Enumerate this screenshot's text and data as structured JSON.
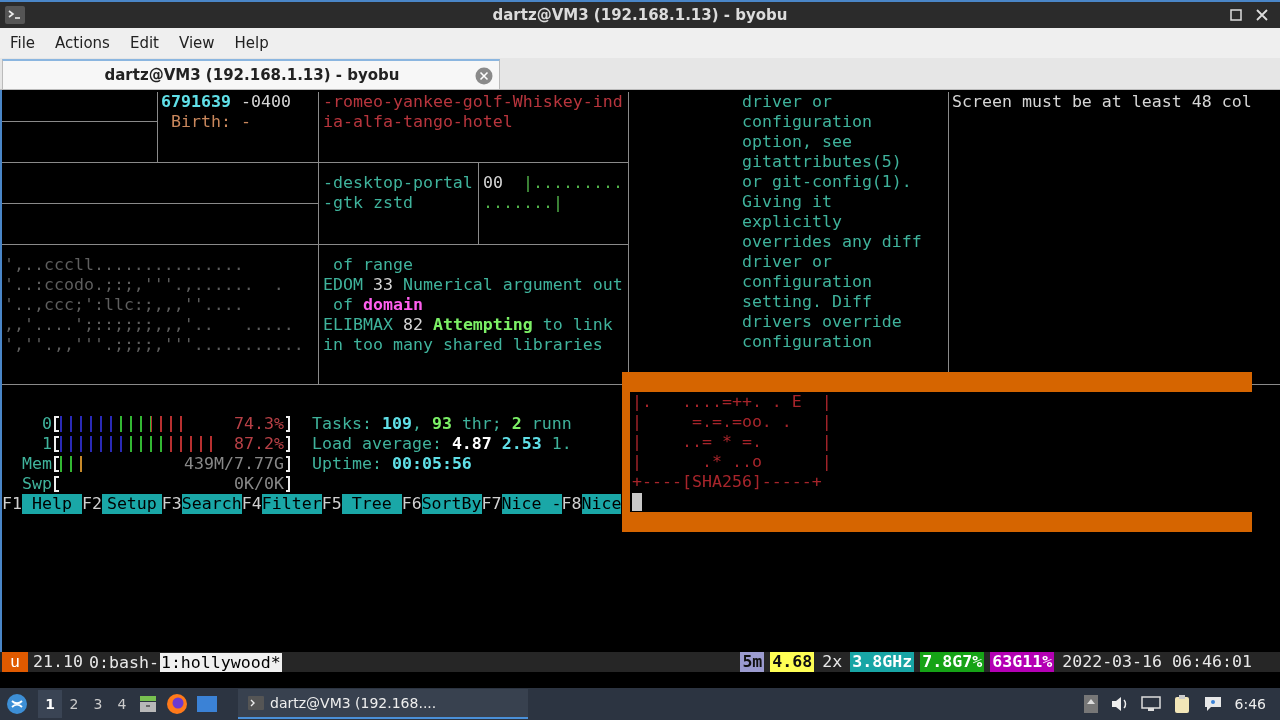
{
  "window": {
    "title": "dartz@VM3 (192.168.1.13) - byobu"
  },
  "menu": [
    "File",
    "Actions",
    "Edit",
    "View",
    "Help"
  ],
  "tabs": [
    {
      "label": "dartz@VM3 (192.168.1.13) - byobu",
      "selected": true
    }
  ],
  "panes": [
    {
      "lines": [
        [
          {
            "text": "6791639",
            "kind": "value"
          },
          {
            "text": " -0400",
            "kind": "plain"
          }
        ],
        [
          {
            "text": " Birth: -",
            "kind": "warning"
          }
        ]
      ]
    },
    {
      "lines": [
        [
          {
            "text": "-romeo-yankee-golf-Whiskey-ind",
            "kind": "error"
          }
        ],
        [
          {
            "text": "ia-alfa-tango-hotel",
            "kind": "error"
          }
        ]
      ]
    },
    {
      "lines": [
        [
          {
            "text": "-desktop-portal",
            "kind": "text"
          }
        ],
        [
          {
            "text": "-gtk zstd",
            "kind": "text"
          }
        ]
      ]
    },
    {
      "lines": [
        [
          {
            "text": "00",
            "kind": "plain"
          },
          {
            "text": "  |.........",
            "kind": "dots"
          }
        ],
        [
          {
            "text": ".......|",
            "kind": "dots"
          }
        ]
      ]
    },
    {
      "lines": [
        [
          {
            "text": "',..cccll...............",
            "kind": "dim"
          }
        ],
        [
          {
            "text": "'..:ccodo.;:;,'''.,......  .",
            "kind": "dim"
          }
        ],
        [
          {
            "text": "'..,ccc;':llc:;,,,''....",
            "kind": "dim"
          }
        ],
        [
          {
            "text": ",,'....';::;;;;,,,'..   .....",
            "kind": "dim"
          }
        ],
        [
          {
            "text": "',''.,,'''.;;;;,'''...........",
            "kind": "dim"
          }
        ]
      ]
    },
    {
      "lines": [
        [
          {
            "text": " of range",
            "kind": "text"
          }
        ],
        [
          {
            "text": "EDOM",
            "kind": "text"
          },
          {
            "text": " 33 ",
            "kind": "plain"
          },
          {
            "text": "Numerical argument out",
            "kind": "text"
          }
        ],
        [
          {
            "text": " of ",
            "kind": "text"
          },
          {
            "text": "domain",
            "kind": "keyword"
          }
        ],
        [
          {
            "text": "ELIBMAX",
            "kind": "text"
          },
          {
            "text": " 82 ",
            "kind": "plain"
          },
          {
            "text": "Attempting",
            "kind": "success"
          },
          {
            "text": " to link",
            "kind": "text"
          }
        ],
        [
          {
            "text": "in too many shared libraries",
            "kind": "text"
          }
        ]
      ]
    },
    {
      "lines": [
        [
          {
            "text": "driver or",
            "kind": "text"
          }
        ],
        [
          {
            "text": "configuration",
            "kind": "text"
          }
        ],
        [
          {
            "text": "option, see",
            "kind": "text"
          }
        ],
        [
          {
            "text": "gitattributes(5)",
            "kind": "text"
          }
        ],
        [
          {
            "text": "or git-config(1).",
            "kind": "text"
          }
        ],
        [
          {
            "text": "Giving it",
            "kind": "text"
          }
        ],
        [
          {
            "text": "explicitly",
            "kind": "text"
          }
        ],
        [
          {
            "text": "overrides any diff",
            "kind": "text"
          }
        ],
        [
          {
            "text": "driver or",
            "kind": "text"
          }
        ],
        [
          {
            "text": "configuration",
            "kind": "text"
          }
        ],
        [
          {
            "text": "setting. Diff",
            "kind": "text"
          }
        ],
        [
          {
            "text": "drivers override",
            "kind": "text"
          }
        ],
        [
          {
            "text": "configuration",
            "kind": "text"
          }
        ]
      ]
    },
    {
      "lines": [
        [
          {
            "text": "Screen must be at least 48 col",
            "kind": "plain"
          }
        ]
      ]
    }
  ],
  "htop": {
    "meters": [
      {
        "label": "0",
        "kind": "cpu",
        "level": 0.743,
        "reading": "74.3%"
      },
      {
        "label": "1",
        "kind": "cpu",
        "level": 0.872,
        "reading": "87.2%"
      },
      {
        "label": "Mem",
        "kind": "memory",
        "level": 0.2,
        "reading": "439M/7.77G"
      },
      {
        "label": "Swp",
        "kind": "memory",
        "level": 0,
        "reading": "0K/0K"
      }
    ],
    "stats": [
      [
        {
          "text": "Tasks: ",
          "kind": "text"
        },
        {
          "text": "109",
          "kind": "value"
        },
        {
          "text": ", ",
          "kind": "text"
        },
        {
          "text": "93",
          "kind": "success"
        },
        {
          "text": " thr; ",
          "kind": "text"
        },
        {
          "text": "2",
          "kind": "success"
        },
        {
          "text": " runn",
          "kind": "text"
        }
      ],
      [
        {
          "text": "Load average: ",
          "kind": "text"
        },
        {
          "text": "4.87",
          "kind": "bright"
        },
        {
          "text": " 2.53",
          "kind": "value"
        },
        {
          "text": " 1.",
          "kind": "text"
        }
      ],
      [
        {
          "text": "Uptime: ",
          "kind": "text"
        },
        {
          "text": "00:05:56",
          "kind": "value"
        }
      ]
    ],
    "function_keys": [
      {
        "key": "F1",
        "label": "Help"
      },
      {
        "key": "F2",
        "label": "Setup"
      },
      {
        "key": "F3",
        "label": "Search"
      },
      {
        "key": "F4",
        "label": "Filter"
      },
      {
        "key": "F5",
        "label": "Tree"
      },
      {
        "key": "F6",
        "label": "SortBy"
      },
      {
        "key": "F7",
        "label": "Nice -"
      },
      {
        "key": "F8",
        "label": "Nice"
      }
    ]
  },
  "popup": {
    "lines": [
      "|.   ....=++. . E  |",
      "|     =.=.=oo. .   |",
      "|    ..= * =.      |",
      "|      .* ..o      |",
      "+----[SHA256]-----+"
    ]
  },
  "status_bar": {
    "left": [
      {
        "text": "u",
        "color": "#e05a00"
      },
      {
        "text": "21.10"
      }
    ],
    "windows": [
      {
        "label": "0:bash-",
        "selected": false
      },
      {
        "label": "1:hollywood*",
        "selected": true
      }
    ],
    "right": [
      {
        "text": "5m",
        "color": "#9b9bcf"
      },
      {
        "text": "4.68",
        "color": "#ffff55"
      },
      {
        "text": "2x"
      },
      {
        "text": "3.8GHz",
        "color": "#18a5a5"
      },
      {
        "text": "7.8G7%",
        "color": "#16a316"
      },
      {
        "text": "63G11%",
        "color": "#b400b4"
      },
      {
        "text": "2022-03-16 06:46:01"
      }
    ]
  },
  "taskbar": {
    "workspaces": [
      {
        "label": "1",
        "selected": true
      },
      {
        "label": "2",
        "selected": false
      },
      {
        "label": "3",
        "selected": false
      },
      {
        "label": "4",
        "selected": false
      }
    ],
    "tasks": [
      {
        "label": "dartz@VM3 (192.168....",
        "selected": true
      }
    ],
    "clock": "6:46"
  }
}
